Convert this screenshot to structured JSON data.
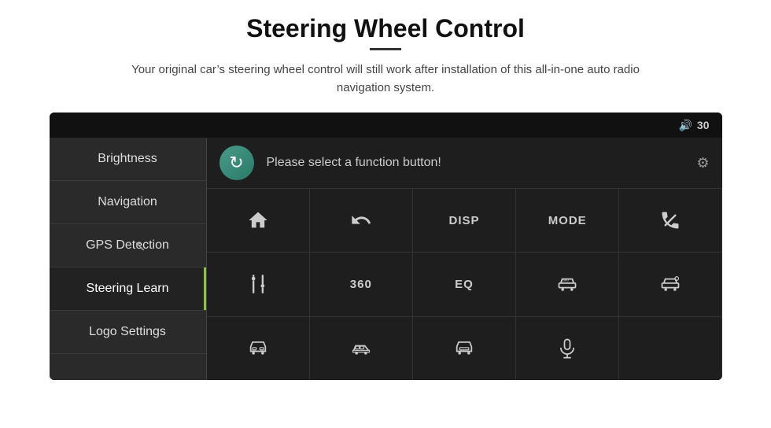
{
  "header": {
    "title": "Steering Wheel Control",
    "subtitle": "Your original car’s steering wheel control will still work after installation of this all-in-one auto radio navigation system."
  },
  "device": {
    "volume_icon": "🔊",
    "volume_value": "30"
  },
  "sidebar": {
    "items": [
      {
        "id": "brightness",
        "label": "Brightness",
        "active": false
      },
      {
        "id": "navigation",
        "label": "Navigation",
        "active": false
      },
      {
        "id": "gps-detection",
        "label": "GPS Detection",
        "active": false
      },
      {
        "id": "steering-learn",
        "label": "Steering Learn",
        "active": true
      },
      {
        "id": "logo-settings",
        "label": "Logo Settings",
        "active": false
      }
    ]
  },
  "function_panel": {
    "prompt": "Please select a function button!"
  },
  "grid": {
    "rows": [
      [
        {
          "id": "home",
          "type": "icon",
          "icon": "home"
        },
        {
          "id": "back",
          "type": "icon",
          "icon": "back"
        },
        {
          "id": "disp",
          "type": "label",
          "label": "DISP"
        },
        {
          "id": "mode",
          "type": "label",
          "label": "MODE"
        },
        {
          "id": "phone-cancel",
          "type": "icon",
          "icon": "phone-cancel"
        }
      ],
      [
        {
          "id": "eq-settings",
          "type": "icon",
          "icon": "eq-sliders"
        },
        {
          "id": "360-label",
          "type": "label",
          "label": "360"
        },
        {
          "id": "eq-label",
          "type": "label",
          "label": "EQ"
        },
        {
          "id": "car-360",
          "type": "icon",
          "icon": "car-360"
        },
        {
          "id": "car-settings",
          "type": "icon",
          "icon": "car-settings"
        }
      ],
      [
        {
          "id": "car-front",
          "type": "icon",
          "icon": "car-front"
        },
        {
          "id": "car-side",
          "type": "icon",
          "icon": "car-side"
        },
        {
          "id": "car-rear",
          "type": "icon",
          "icon": "car-rear"
        },
        {
          "id": "mic",
          "type": "icon",
          "icon": "mic"
        },
        {
          "id": "empty",
          "type": "empty"
        }
      ]
    ]
  }
}
